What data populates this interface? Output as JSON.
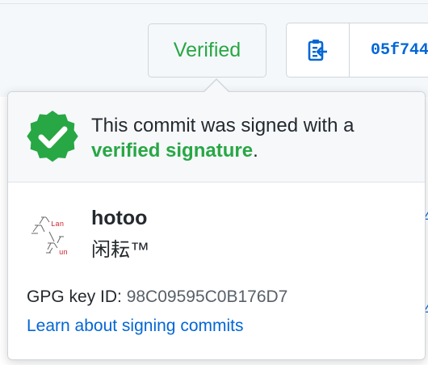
{
  "badge": {
    "label": "Verified"
  },
  "toolbar": {
    "copy_icon": "clipboard-copy-icon",
    "sha": "05f744"
  },
  "popover": {
    "heading_prefix": "This commit was signed with a",
    "heading_strong": "verified signature",
    "heading_suffix": ".",
    "seal_icon": "verified-check-icon",
    "user": {
      "login": "hotoo",
      "name": "闲耘™",
      "avatar_icon": "ascii-art-avatar"
    },
    "gpg_label": "GPG key ID: ",
    "gpg_id": "98C09595C0B176D7",
    "learn_link": "Learn about signing commits"
  },
  "colors": {
    "verified": "#28a745",
    "link": "#0366d6",
    "border": "#d1d5da",
    "header_bg": "#f6f8fa"
  }
}
